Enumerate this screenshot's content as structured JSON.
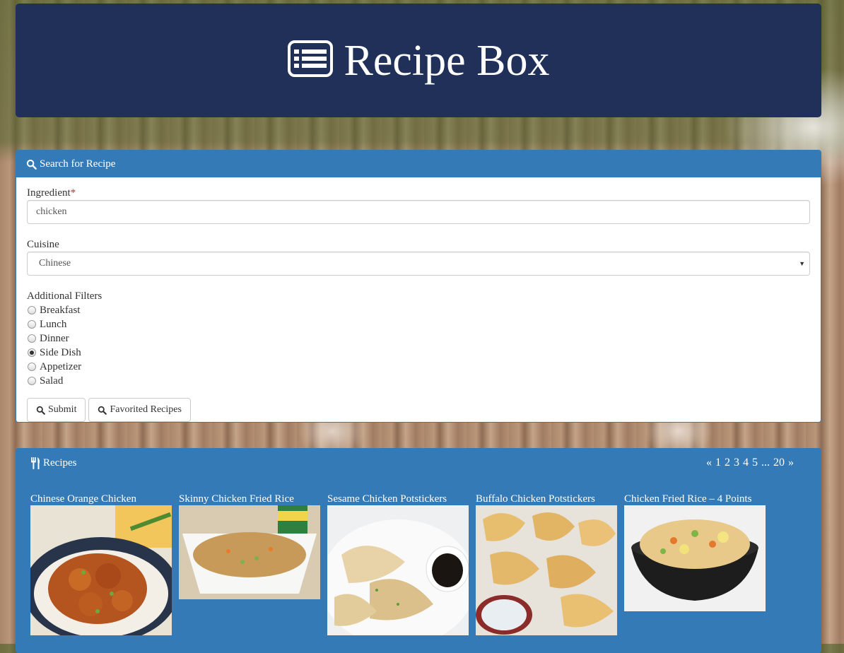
{
  "header": {
    "title": "Recipe Box",
    "icon": "list-alt-icon"
  },
  "search_panel": {
    "heading": "Search for Recipe",
    "ingredient": {
      "label": "Ingredient",
      "required_marker": "*",
      "value": "chicken"
    },
    "cuisine": {
      "label": "Cuisine",
      "selected": "Chinese"
    },
    "filters": {
      "label": "Additional Filters",
      "options": [
        "Breakfast",
        "Lunch",
        "Dinner",
        "Side Dish",
        "Appetizer",
        "Salad"
      ],
      "selected": "Side Dish"
    },
    "buttons": {
      "submit": "Submit",
      "favorites": "Favorited Recipes"
    }
  },
  "recipes_panel": {
    "heading": "Recipes",
    "pager": {
      "prev": "«",
      "pages": [
        "1",
        "2",
        "3",
        "4",
        "5"
      ],
      "ellipsis": "...",
      "last": "20",
      "next": "»"
    },
    "cards": [
      {
        "title": "Chinese Orange Chicken"
      },
      {
        "title": "Skinny Chicken Fried Rice"
      },
      {
        "title": "Sesame Chicken Potstickers"
      },
      {
        "title": "Buffalo Chicken Potstickers"
      },
      {
        "title": "Chicken Fried Rice – 4 Points"
      }
    ]
  },
  "colors": {
    "header_bg": "#203059",
    "panel_primary": "#337ab7",
    "required": "#c9302c"
  }
}
